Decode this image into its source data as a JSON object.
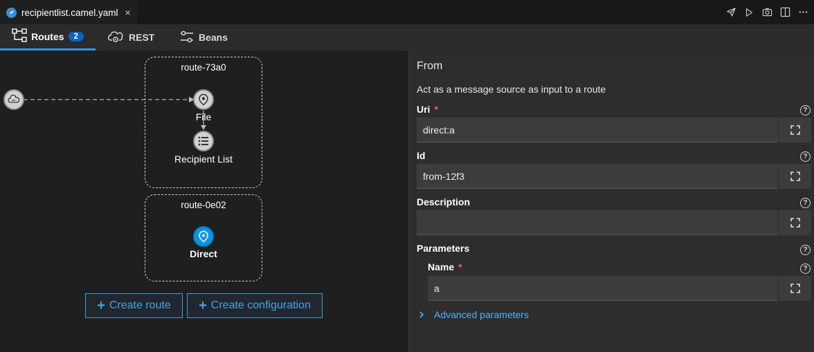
{
  "editor_tab": {
    "title": "recipientlist.camel.yaml",
    "close": "×"
  },
  "nav": {
    "routes_label": "Routes",
    "routes_count": "2",
    "rest_label": "REST",
    "beans_label": "Beans"
  },
  "canvas": {
    "routes": [
      {
        "title": "route-73a0",
        "nodes": [
          {
            "label": "File"
          },
          {
            "label": "Recipient List"
          }
        ]
      },
      {
        "title": "route-0e02",
        "nodes": [
          {
            "label": "Direct"
          }
        ]
      }
    ],
    "create_route_label": "Create route",
    "create_configuration_label": "Create configuration"
  },
  "panel": {
    "title": "From",
    "description": "Act as a message source as input to a route",
    "uri": {
      "label": "Uri",
      "required": "*",
      "value": "direct:a"
    },
    "id": {
      "label": "Id",
      "value": "from-12f3"
    },
    "description_field": {
      "label": "Description",
      "value": ""
    },
    "parameters": {
      "label": "Parameters"
    },
    "name": {
      "label": "Name",
      "required": "*",
      "value": "a"
    },
    "advanced_label": "Advanced parameters",
    "help_glyph": "?"
  },
  "colors": {
    "accent": "#2b9af3",
    "link": "#4fb3ff",
    "required": "#ff5b5b",
    "node_active": "#0a96e8"
  }
}
